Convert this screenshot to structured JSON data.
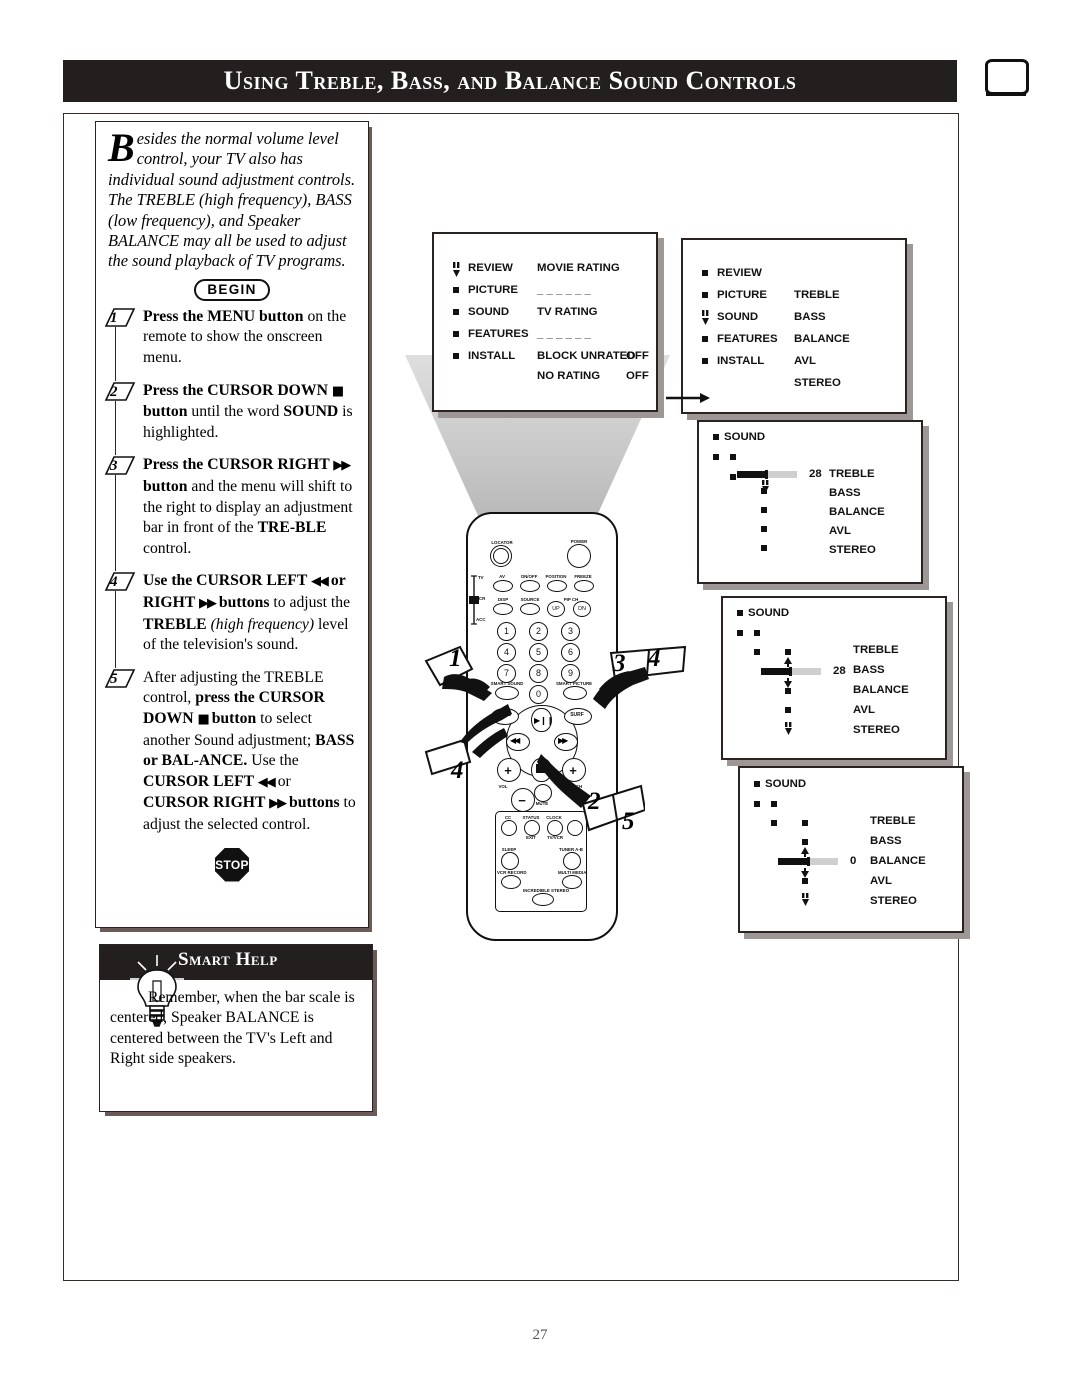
{
  "header": {
    "title": "Using Treble, Bass, and Balance Sound Controls",
    "tv_icon": "tv-screen-icon"
  },
  "intro": {
    "dropcap": "B",
    "text": "esides the normal volume level control, your TV also has individual sound adjustment controls. The TREBLE (high frequency), BASS (low frequency), and Speaker BALANCE may all be used to adjust the sound playback of TV programs."
  },
  "begin_label": "BEGIN",
  "stop_label": "STOP",
  "steps": [
    {
      "number": "1",
      "parts": [
        {
          "t": "Press the MENU button",
          "s": "b"
        },
        {
          "t": " on the remote to show the onscreen menu.",
          "s": "n"
        }
      ]
    },
    {
      "number": "2",
      "parts": [
        {
          "t": "Press the CURSOR DOWN ",
          "s": "b"
        },
        {
          "t": "■",
          "s": "g"
        },
        {
          "t": " button",
          "s": "b"
        },
        {
          "t": " until the word ",
          "s": "n"
        },
        {
          "t": "SOUND",
          "s": "b"
        },
        {
          "t": " is highlighted.",
          "s": "n"
        }
      ]
    },
    {
      "number": "3",
      "parts": [
        {
          "t": "Press the CURSOR RIGHT ",
          "s": "b"
        },
        {
          "t": "▶▶",
          "s": "g"
        },
        {
          "t": " button",
          "s": "b"
        },
        {
          "t": " and the menu will shift to the right to display an adjustment bar in front of the ",
          "s": "n"
        },
        {
          "t": "TRE-BLE",
          "s": "b"
        },
        {
          "t": " control.",
          "s": "n"
        }
      ]
    },
    {
      "number": "4",
      "parts": [
        {
          "t": "Use the CURSOR LEFT ",
          "s": "b"
        },
        {
          "t": "◀◀",
          "s": "g"
        },
        {
          "t": " or RIGHT ",
          "s": "b"
        },
        {
          "t": "▶▶",
          "s": "g"
        },
        {
          "t": " buttons",
          "s": "b"
        },
        {
          "t": " to adjust the ",
          "s": "n"
        },
        {
          "t": "TREBLE ",
          "s": "b"
        },
        {
          "t": "(high frequency)",
          "s": "i"
        },
        {
          "t": " level of the television's sound.",
          "s": "n"
        }
      ]
    },
    {
      "number": "5",
      "parts": [
        {
          "t": "After adjusting the TREBLE control, ",
          "s": "n"
        },
        {
          "t": "press the CURSOR DOWN ",
          "s": "b"
        },
        {
          "t": "■",
          "s": "g"
        },
        {
          "t": " button",
          "s": "b"
        },
        {
          "t": " to select another Sound adjustment; ",
          "s": "n"
        },
        {
          "t": "BASS or BAL-ANCE.",
          "s": "b"
        },
        {
          "t": " Use the ",
          "s": "n"
        },
        {
          "t": "CURSOR LEFT ",
          "s": "b"
        },
        {
          "t": "◀◀",
          "s": "g"
        },
        {
          "t": " or ",
          "s": "n"
        },
        {
          "t": "CURSOR RIGHT ",
          "s": "b"
        },
        {
          "t": "▶▶",
          "s": "g"
        },
        {
          "t": " buttons",
          "s": "b"
        },
        {
          "t": " to adjust the selected control.",
          "s": "n"
        }
      ]
    }
  ],
  "smart_help": {
    "title": "Smart Help",
    "icon": "lightbulb-icon",
    "text": "Remember, when the bar scale is centered, Speaker BALANCE is centered between the TV's Left and Right side speakers."
  },
  "tv_menus": [
    {
      "id": "menu-review",
      "left_items": [
        "REVIEW",
        "PICTURE",
        "SOUND",
        "FEATURES",
        "INSTALL"
      ],
      "highlighted": "REVIEW",
      "right_items": [
        {
          "label": "MOVIE RATING",
          "value": ""
        },
        {
          "label": "_ _ _ _ _ _",
          "value": ""
        },
        {
          "label": "TV RATING",
          "value": ""
        },
        {
          "label": "_ _ _ _ _ _",
          "value": ""
        },
        {
          "label": "BLOCK UNRATED",
          "value": "OFF"
        },
        {
          "label": "NO RATING",
          "value": "OFF"
        }
      ]
    },
    {
      "id": "menu-sound",
      "left_items": [
        "REVIEW",
        "PICTURE",
        "SOUND",
        "FEATURES",
        "INSTALL"
      ],
      "highlighted": "SOUND",
      "right_items": [
        {
          "label": "TREBLE",
          "value": ""
        },
        {
          "label": "BASS",
          "value": ""
        },
        {
          "label": "BALANCE",
          "value": ""
        },
        {
          "label": "AVL",
          "value": ""
        },
        {
          "label": "STEREO",
          "value": ""
        }
      ]
    },
    {
      "id": "menu-treble",
      "header": "SOUND",
      "options": [
        "TREBLE",
        "BASS",
        "BALANCE",
        "AVL",
        "STEREO"
      ],
      "selected": "TREBLE",
      "value": "28",
      "bar_percent": 48
    },
    {
      "id": "menu-bass",
      "header": "SOUND",
      "options": [
        "TREBLE",
        "BASS",
        "BALANCE",
        "AVL",
        "STEREO"
      ],
      "selected": "BASS",
      "value": "28",
      "bar_percent": 48
    },
    {
      "id": "menu-balance",
      "header": "SOUND",
      "options": [
        "TREBLE",
        "BASS",
        "BALANCE",
        "AVL",
        "STEREO"
      ],
      "selected": "BALANCE",
      "value": "0",
      "bar_percent": 50
    }
  ],
  "remote": {
    "top": {
      "locator": "LOCATOR",
      "power": "POWER"
    },
    "mode_slider": [
      "TV",
      "VCR",
      "ACC"
    ],
    "row1": [
      "AV",
      "ON/OFF",
      "POSITION",
      "FREEZE"
    ],
    "row2": [
      "DISP",
      "SOURCE",
      "PIP CH"
    ],
    "pip_up": "UP",
    "pip_dn": "DN",
    "keypad": [
      "1",
      "2",
      "3",
      "4",
      "5",
      "6",
      "7",
      "8",
      "9",
      "0"
    ],
    "smart_sound": "SMART SOUND",
    "smart_picture": "SMART PICTURE",
    "menu": "MENU",
    "surf": "SURF",
    "vol": "VOL",
    "ch": "CH",
    "mute": "MUTE",
    "lower": [
      "CC",
      "STATUS",
      "CLOCK",
      "EXIT",
      "TV/VCR",
      "SLEEP",
      "TUNER A-B",
      "VCR RECORD",
      "MULTI MEDIA",
      "INCREDIBLE STEREO"
    ]
  },
  "callouts": [
    "1",
    "2",
    "3",
    "4",
    "4",
    "5"
  ],
  "page_number": "27"
}
